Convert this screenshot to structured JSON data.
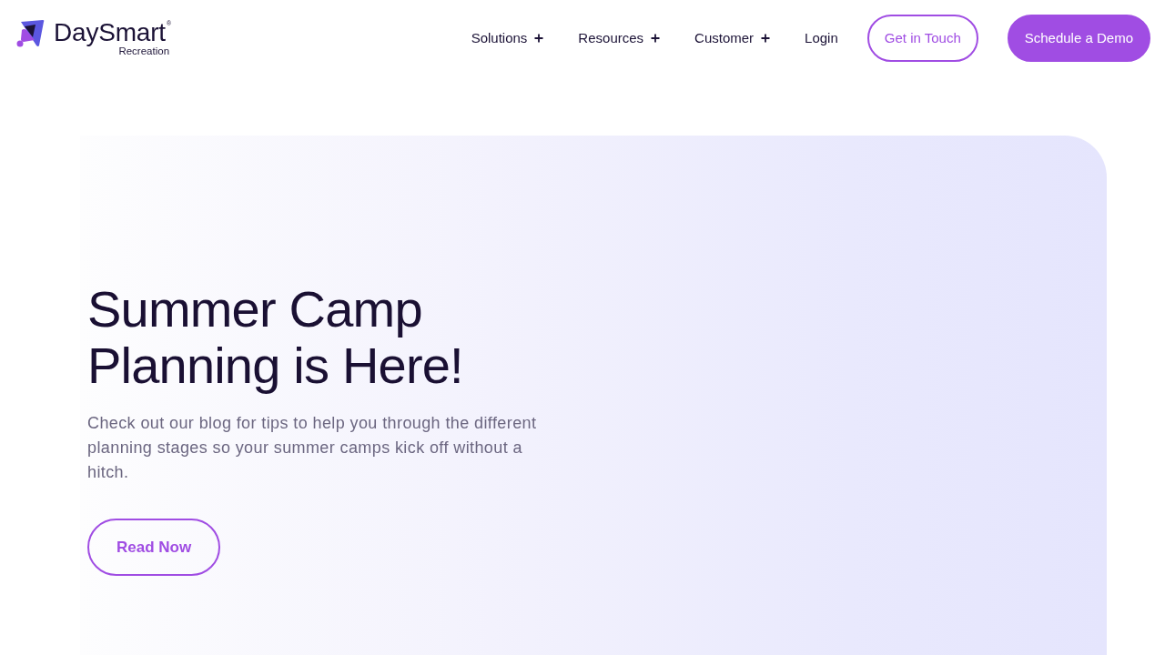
{
  "header": {
    "logo": {
      "name": "DaySmart",
      "registered_mark": "®",
      "tagline": "Recreation"
    },
    "nav": [
      {
        "label": "Solutions",
        "kind": "menu"
      },
      {
        "label": "Resources",
        "kind": "menu"
      },
      {
        "label": "Customer",
        "kind": "menu"
      },
      {
        "label": "Login",
        "kind": "link"
      }
    ],
    "actions": [
      {
        "label": "Get in Touch",
        "kind": "outline"
      },
      {
        "label": "Schedule a Demo",
        "kind": "filled"
      }
    ]
  },
  "hero": {
    "title": "Summer Camp Planning is Here!",
    "description": "Check out our blog for tips to help you through the different planning stages so your summer camps kick off without a hitch.",
    "button": {
      "label": "Read Now"
    }
  }
}
